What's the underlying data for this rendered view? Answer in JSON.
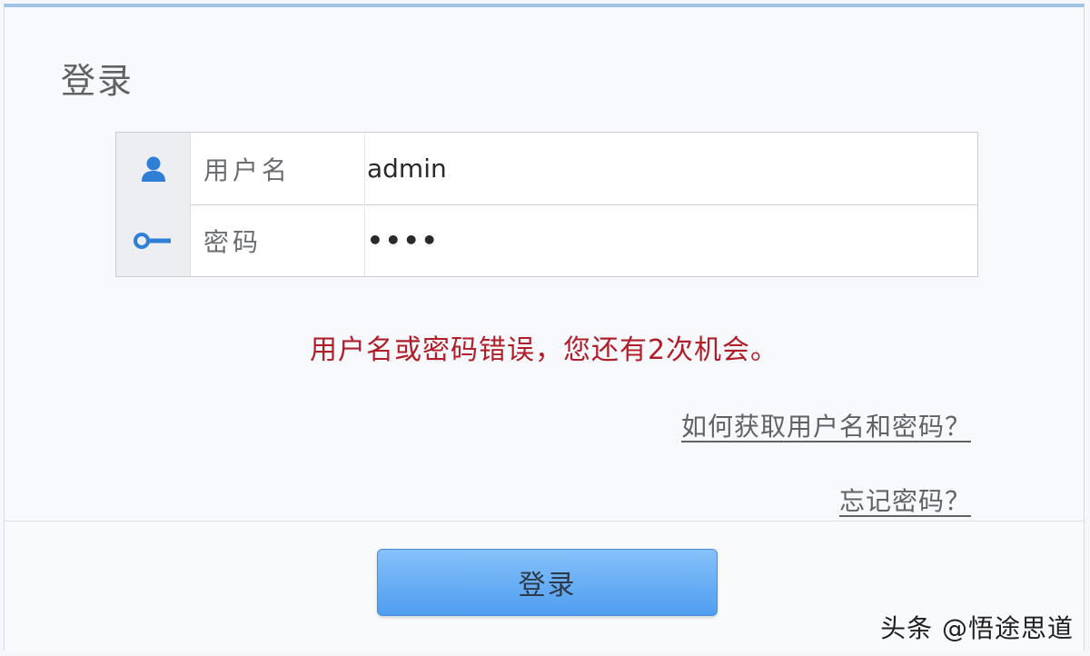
{
  "dialog": {
    "title": "登录"
  },
  "form": {
    "username": {
      "label": "用户名",
      "value": "admin",
      "icon": "user-icon"
    },
    "password": {
      "label": "密码",
      "value": "••••",
      "icon": "key-icon"
    }
  },
  "error_message": "用户名或密码错误，您还有2次机会。",
  "links": {
    "get_credentials": "如何获取用户名和密码？",
    "forgot_password": "忘记密码？"
  },
  "footer": {
    "login_button": "登录"
  },
  "watermark": "头条 @悟途思道",
  "colors": {
    "accent": "#5aa6f3",
    "error": "#b01e2a",
    "icon": "#2f7fd6"
  }
}
